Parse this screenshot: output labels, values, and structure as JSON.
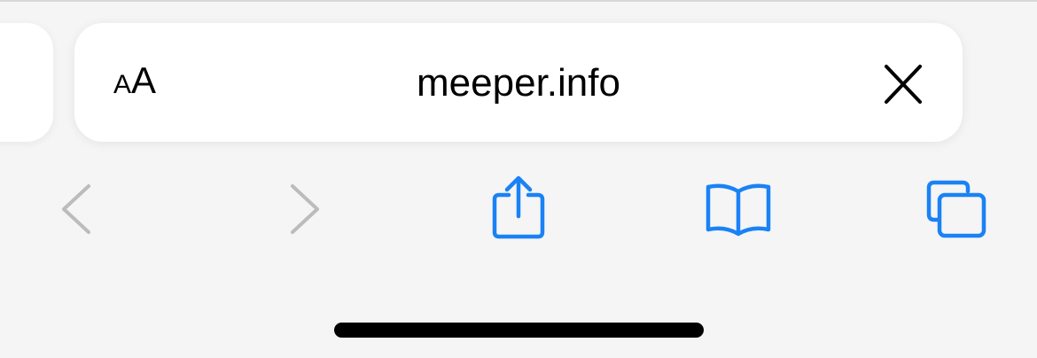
{
  "address_bar": {
    "reader_small": "A",
    "reader_large": "A",
    "url": "meeper.info"
  },
  "icons": {
    "aa": "text-size-icon",
    "close": "close-icon",
    "back": "chevron-left-icon",
    "forward": "chevron-right-icon",
    "share": "share-icon",
    "bookmarks": "book-icon",
    "tabs": "tabs-icon"
  },
  "colors": {
    "accent": "#1a82f5",
    "disabled": "#bcbcbc",
    "background": "#f5f5f5",
    "bar": "#ffffff"
  }
}
